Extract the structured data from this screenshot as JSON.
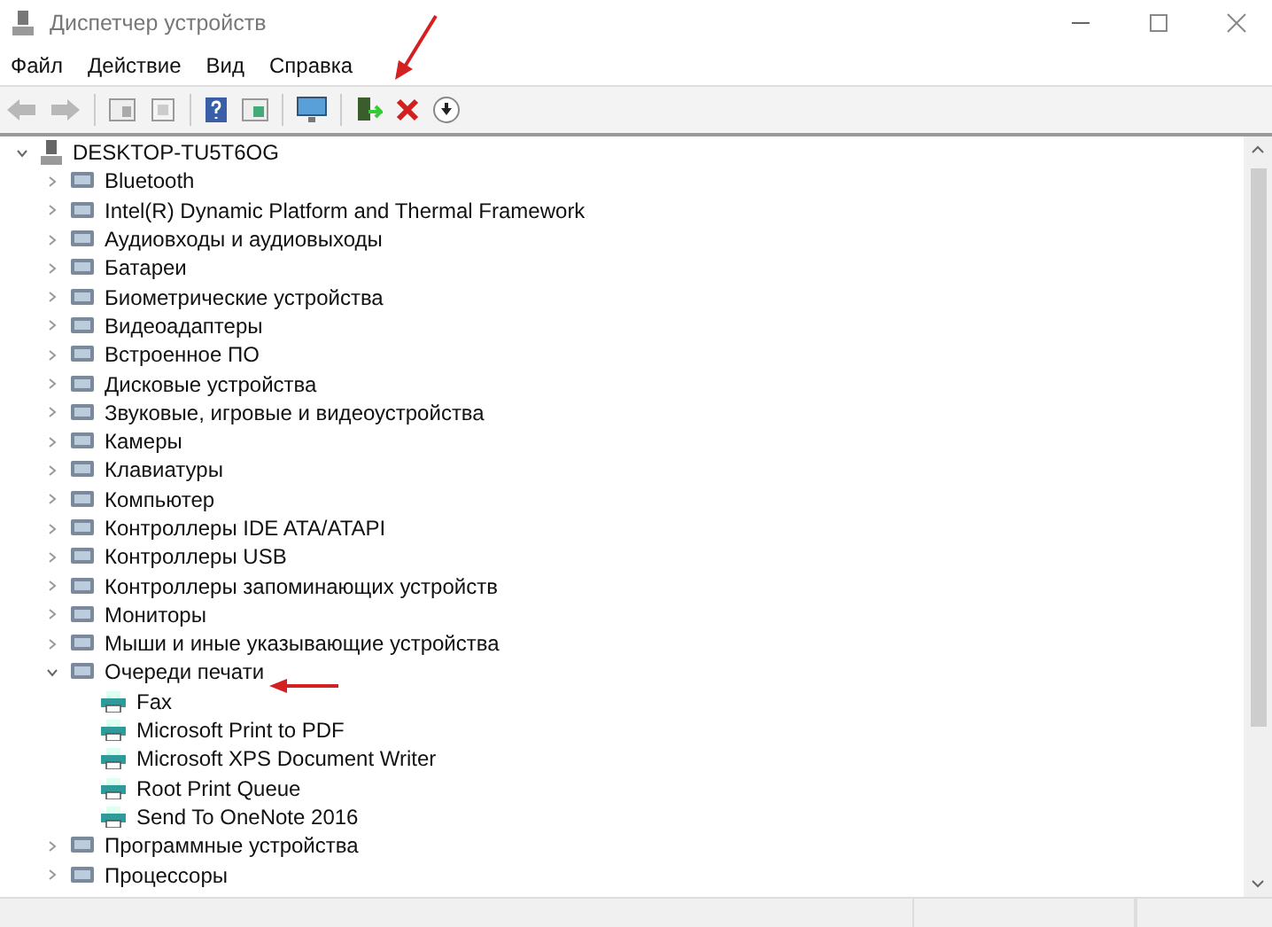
{
  "window": {
    "title": "Диспетчер устройств"
  },
  "menu": [
    {
      "label": "Файл"
    },
    {
      "label": "Действие"
    },
    {
      "label": "Вид"
    },
    {
      "label": "Справка"
    }
  ],
  "tree": {
    "label": "DESKTOP-TU5T6OG",
    "expanded": true,
    "children": [
      {
        "label": "Bluetooth",
        "expanded": false
      },
      {
        "label": "Intel(R) Dynamic Platform and Thermal Framework",
        "expanded": false
      },
      {
        "label": "Аудиовходы и аудиовыходы",
        "expanded": false
      },
      {
        "label": "Батареи",
        "expanded": false
      },
      {
        "label": "Биометрические устройства",
        "expanded": false
      },
      {
        "label": "Видеоадаптеры",
        "expanded": false
      },
      {
        "label": "Встроенное ПО",
        "expanded": false
      },
      {
        "label": "Дисковые устройства",
        "expanded": false
      },
      {
        "label": "Звуковые, игровые и видеоустройства",
        "expanded": false
      },
      {
        "label": "Камеры",
        "expanded": false
      },
      {
        "label": "Клавиатуры",
        "expanded": false
      },
      {
        "label": "Компьютер",
        "expanded": false
      },
      {
        "label": "Контроллеры IDE ATA/ATAPI",
        "expanded": false
      },
      {
        "label": "Контроллеры USB",
        "expanded": false
      },
      {
        "label": "Контроллеры запоминающих устройств",
        "expanded": false
      },
      {
        "label": "Мониторы",
        "expanded": false
      },
      {
        "label": "Мыши и иные указывающие устройства",
        "expanded": false
      },
      {
        "label": "Очереди печати",
        "expanded": true,
        "children": [
          {
            "label": "Fax"
          },
          {
            "label": "Microsoft Print to PDF"
          },
          {
            "label": "Microsoft XPS Document Writer"
          },
          {
            "label": "Root Print Queue"
          },
          {
            "label": "Send To OneNote 2016"
          }
        ]
      },
      {
        "label": "Программные устройства",
        "expanded": false
      },
      {
        "label": "Процессоры",
        "expanded": false
      }
    ]
  }
}
